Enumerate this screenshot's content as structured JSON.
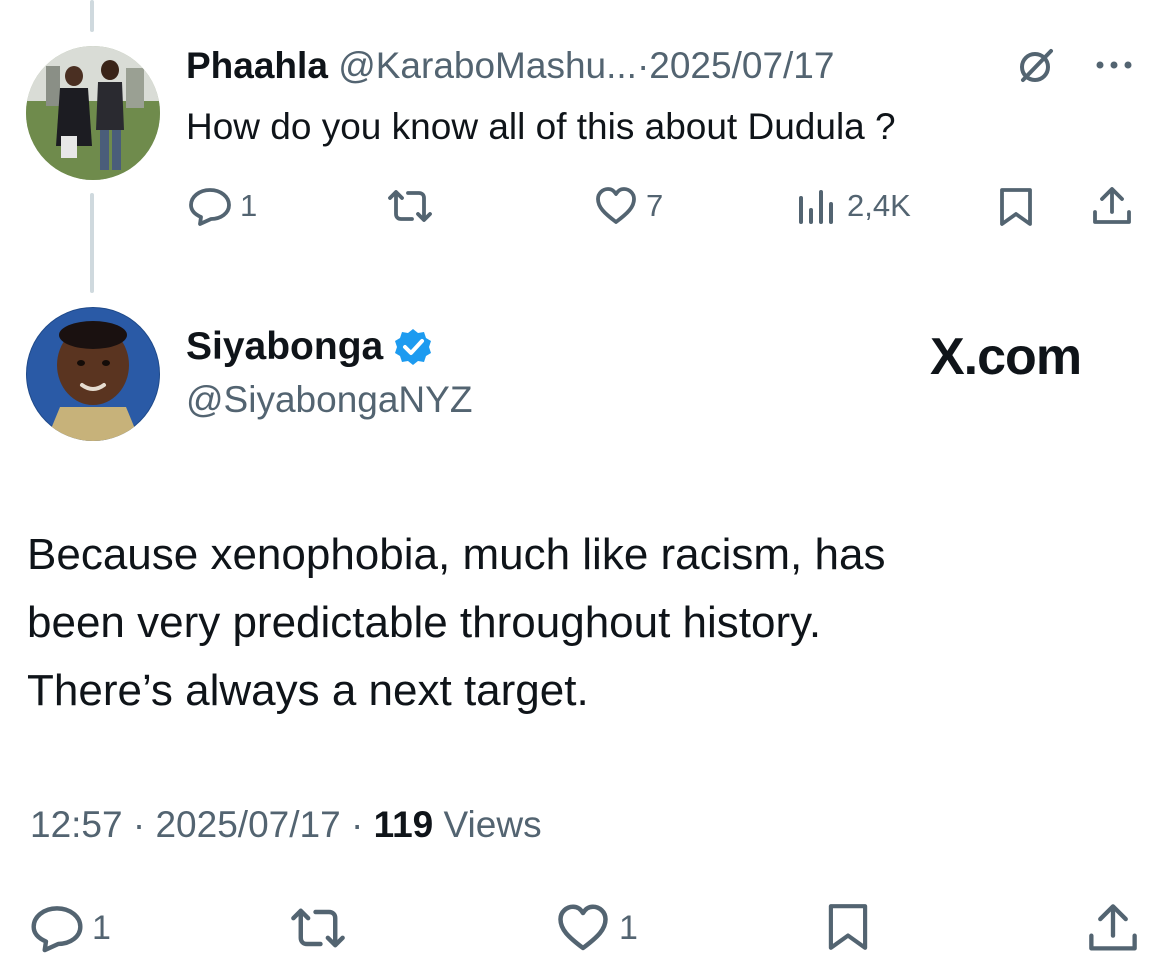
{
  "reply_tweet": {
    "display_name": "Phaahla",
    "handle": "@KaraboMashu...",
    "separator": "·",
    "date": "2025/07/17",
    "text": "How do you know all of this about Dudula ?",
    "actions": {
      "replies": "1",
      "reposts": "",
      "likes": "7",
      "views": "2,4K"
    },
    "icons": [
      "grok-icon",
      "more-icon",
      "reply-icon",
      "repost-icon",
      "like-icon",
      "views-icon",
      "bookmark-icon",
      "share-icon"
    ]
  },
  "main_tweet": {
    "display_name": "Siyabonga",
    "handle": "@SiyabongaNYZ",
    "verified": true,
    "watermark": "X.com",
    "text_lines": [
      "Because xenophobia, much like racism, has",
      "been very predictable throughout history.",
      "There’s always a next target."
    ],
    "time": "12:57",
    "separator": "·",
    "date": "2025/07/17",
    "views_count": "119",
    "views_label": "Views",
    "actions": {
      "replies": "1",
      "reposts": "",
      "likes": "1"
    }
  },
  "colors": {
    "text": "#0f1419",
    "muted": "#536471",
    "thread_line": "#cfd9de",
    "verified": "#1d9bf0"
  }
}
